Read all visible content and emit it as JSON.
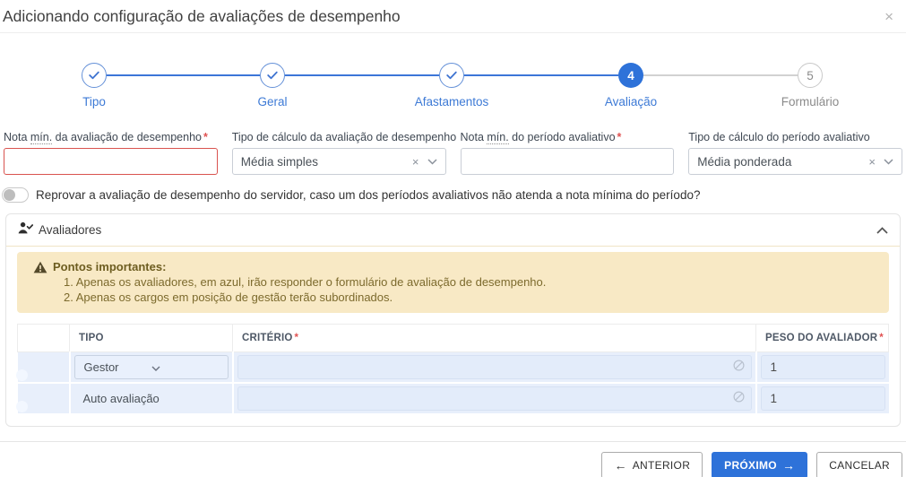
{
  "modal": {
    "title": "Adicionando configuração de avaliações de desempenho"
  },
  "stepper": {
    "steps": [
      {
        "label": "Tipo",
        "state": "done"
      },
      {
        "label": "Geral",
        "state": "done"
      },
      {
        "label": "Afastamentos",
        "state": "done"
      },
      {
        "label": "Avaliação",
        "state": "current",
        "number": "4"
      },
      {
        "label": "Formulário",
        "state": "pending",
        "number": "5"
      }
    ]
  },
  "form": {
    "fields": [
      {
        "label_prefix": "Nota ",
        "label_abbr": "mín.",
        "label_suffix": " da avaliação de desempenho",
        "required": true,
        "value": "",
        "type": "text"
      },
      {
        "label": "Tipo de cálculo da avaliação de desempenho",
        "required": false,
        "value": "Média simples",
        "type": "select"
      },
      {
        "label_prefix": "Nota ",
        "label_abbr": "mín.",
        "label_suffix": " do período avaliativo",
        "required": true,
        "value": "",
        "type": "text"
      },
      {
        "label": "Tipo de cálculo do período avaliativo",
        "required": false,
        "value": "Média ponderada",
        "type": "select"
      }
    ],
    "reprove_toggle": {
      "label": "Reprovar a avaliação de desempenho do servidor, caso um dos períodos avaliativos não atenda a nota mínima do período?",
      "state": "off"
    }
  },
  "panel": {
    "title": "Avaliadores",
    "collapsed": false,
    "alert": {
      "title": "Pontos importantes:",
      "items": [
        "1. Apenas os avaliadores, em azul, irão responder o formulário de avaliação de desempenho.",
        "2. Apenas os cargos em posição de gestão terão subordinados."
      ]
    },
    "table": {
      "headers": {
        "tipo": "TIPO",
        "criterio": "CRITÉRIO",
        "peso": "PESO DO AVALIADOR"
      },
      "rows": [
        {
          "enabled": true,
          "tipo": "Gestor",
          "tipo_is_select": true,
          "criterio": "",
          "criterio_disabled": true,
          "peso": "1"
        },
        {
          "enabled": true,
          "tipo": "Auto avaliação",
          "tipo_is_select": false,
          "criterio": "",
          "criterio_disabled": true,
          "peso": "1"
        }
      ]
    }
  },
  "footer": {
    "anterior": "ANTERIOR",
    "proximo": "PRÓXIMO",
    "cancelar": "CANCELAR"
  },
  "icons": {
    "close": "×",
    "clear": "×",
    "required": "*",
    "arrow_left": "←",
    "arrow_right": "→"
  },
  "colors": {
    "accent": "#2e72d9",
    "danger": "#d9534f",
    "warning_bg": "#f8e9c5",
    "warning_text": "#7c6a2d",
    "row_bg": "#e8effb",
    "toggle_on": "#7da0e0"
  }
}
